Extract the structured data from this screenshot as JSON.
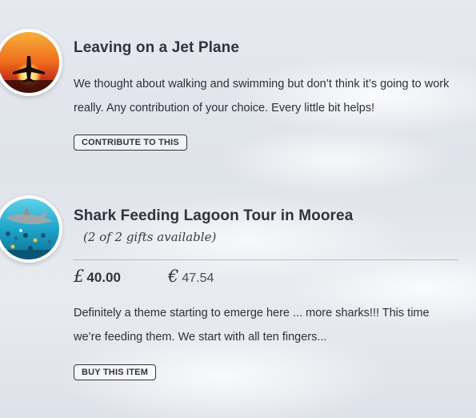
{
  "gifts": [
    {
      "title": "Leaving on a Jet Plane",
      "image_icon": "sunset-airplane-image",
      "description": "We thought about walking and swimming but don’t think it’s going to work really. Any contribution of your choice. Every little bit helps!",
      "button_label": "CONTRIBUTE TO THIS"
    },
    {
      "title": "Shark Feeding Lagoon Tour in Moorea",
      "image_icon": "shark-underwater-image",
      "availability": "(2 of 2 gifts available)",
      "price_gbp_symbol": "£",
      "price_gbp": "40.00",
      "price_eur_symbol": "€",
      "price_eur": "47.54",
      "description": "Definitely a theme starting to emerge here ... more sharks!!! This time we’re feeding them. We start with all ten fingers...",
      "button_label": "BUY THIS ITEM"
    }
  ]
}
